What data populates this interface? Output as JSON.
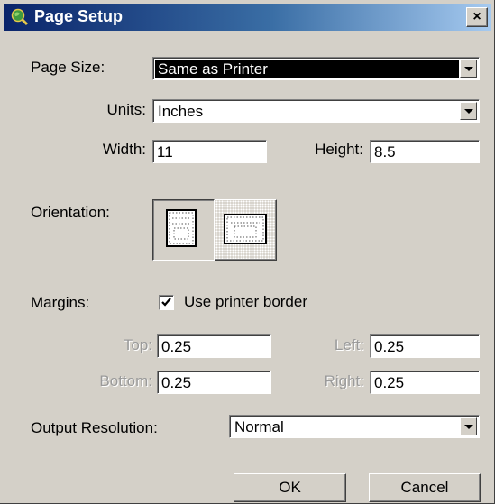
{
  "window": {
    "title": "Page Setup",
    "close_label": "×",
    "icon": "globe-magnifier-icon"
  },
  "page_size": {
    "label": "Page Size:",
    "value": "Same as Printer"
  },
  "units": {
    "label": "Units:",
    "value": "Inches"
  },
  "width": {
    "label": "Width:",
    "value": "11"
  },
  "height": {
    "label": "Height:",
    "value": "8.5"
  },
  "orientation": {
    "label": "Orientation:",
    "selected": "portrait",
    "options": [
      "portrait",
      "landscape"
    ]
  },
  "margins": {
    "label": "Margins:",
    "use_printer_border": {
      "label": "Use printer border",
      "checked": true
    },
    "top": {
      "label": "Top:",
      "value": "0.25"
    },
    "left": {
      "label": "Left:",
      "value": "0.25"
    },
    "bottom": {
      "label": "Bottom:",
      "value": "0.25"
    },
    "right": {
      "label": "Right:",
      "value": "0.25"
    }
  },
  "output_resolution": {
    "label": "Output Resolution:",
    "value": "Normal"
  },
  "buttons": {
    "ok": "OK",
    "cancel": "Cancel"
  },
  "colors": {
    "title_start": "#0a246a",
    "title_end": "#a6caf0",
    "face": "#d4d0c8"
  }
}
